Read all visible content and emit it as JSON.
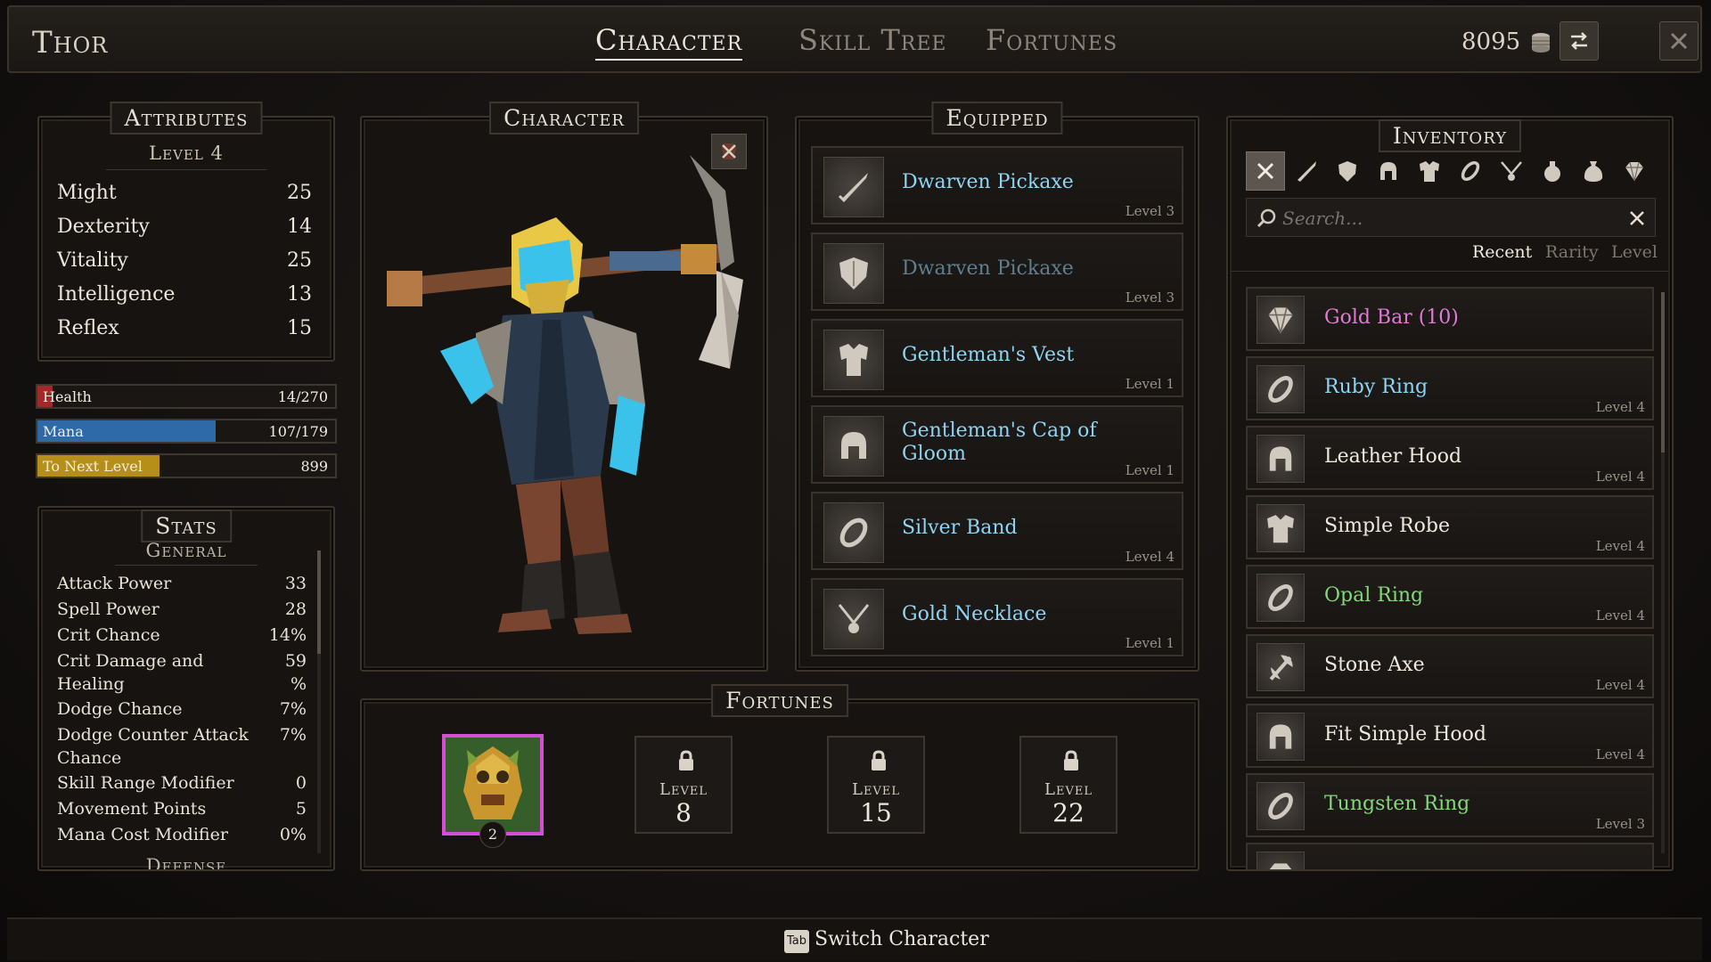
{
  "header": {
    "character_name": "Thor",
    "tabs": [
      {
        "label": "Character",
        "active": true
      },
      {
        "label": "Skill Tree",
        "active": false
      },
      {
        "label": "Fortunes",
        "active": false
      }
    ],
    "gold": "8095",
    "icons": {
      "gold": "coin-stack-icon",
      "switch": "swap-arrows-icon",
      "close": "close-icon"
    }
  },
  "attributes": {
    "title": "Attributes",
    "level": "Level 4",
    "rows": [
      {
        "name": "Might",
        "value": "25"
      },
      {
        "name": "Dexterity",
        "value": "14"
      },
      {
        "name": "Vitality",
        "value": "25"
      },
      {
        "name": "Intelligence",
        "value": "13"
      },
      {
        "name": "Reflex",
        "value": "15"
      }
    ]
  },
  "bars": {
    "health": {
      "label": "Health",
      "value": "14/270",
      "fraction": 0.05,
      "color": "#a3282a"
    },
    "mana": {
      "label": "Mana",
      "value": "107/179",
      "fraction": 0.6,
      "color": "#2e6aa8"
    },
    "xp": {
      "label": "To Next Level",
      "value": "899",
      "fraction": 0.41,
      "color": "#b58f18"
    }
  },
  "stats": {
    "title": "Stats",
    "group": "General",
    "rows": [
      {
        "name": "Attack Power",
        "value": "33"
      },
      {
        "name": "Spell Power",
        "value": "28"
      },
      {
        "name": "Crit Chance",
        "value": "14%"
      },
      {
        "name": "Crit Damage and Healing",
        "value": "59\n%"
      },
      {
        "name": "Dodge Chance",
        "value": "7%"
      },
      {
        "name": "Dodge Counter Attack Chance",
        "value": "7%"
      },
      {
        "name": "Skill Range Modifier",
        "value": "0"
      },
      {
        "name": "Movement Points",
        "value": "5"
      },
      {
        "name": "Mana Cost Modifier",
        "value": "0%"
      }
    ],
    "next_group": "Defense"
  },
  "character_panel": {
    "title": "Character",
    "badge_icon": "unequip-icon"
  },
  "equipped": {
    "title": "Equipped",
    "items": [
      {
        "name": "Dwarven Pickaxe",
        "level": "Level 3",
        "icon": "sword-icon",
        "dim": false
      },
      {
        "name": "Dwarven Pickaxe",
        "level": "Level 3",
        "icon": "shield-icon",
        "dim": true
      },
      {
        "name": "Gentleman's Vest",
        "level": "Level 1",
        "icon": "chest-armor-icon",
        "dim": false
      },
      {
        "name": "Gentleman's Cap of Gloom",
        "level": "Level 1",
        "icon": "helmet-icon",
        "dim": false
      },
      {
        "name": "Silver Band",
        "level": "Level 4",
        "icon": "ring-icon",
        "dim": false
      },
      {
        "name": "Gold Necklace",
        "level": "Level 1",
        "icon": "necklace-icon",
        "dim": false
      }
    ]
  },
  "fortunes": {
    "title": "Fortunes",
    "active_count": "2",
    "locked": [
      {
        "label": "Level",
        "value": "8"
      },
      {
        "label": "Level",
        "value": "15"
      },
      {
        "label": "Level",
        "value": "22"
      }
    ]
  },
  "inventory": {
    "title": "Inventory",
    "search_placeholder": "Search...",
    "filters": [
      "all-filter-icon",
      "weapon-filter-icon",
      "shield-filter-icon",
      "helmet-filter-icon",
      "armor-filter-icon",
      "ring-filter-icon",
      "necklace-filter-icon",
      "potion-filter-icon",
      "bag-filter-icon",
      "gem-filter-icon"
    ],
    "sort": {
      "recent": "Recent",
      "rarity": "Rarity",
      "level": "Level"
    },
    "items": [
      {
        "name": "Gold Bar  (10)",
        "level": "",
        "color": "#e279d8",
        "icon": "gem-icon"
      },
      {
        "name": "Ruby Ring",
        "level": "Level 4",
        "color": "#8fd4f2",
        "icon": "ring-icon"
      },
      {
        "name": "Leather Hood",
        "level": "Level 4",
        "color": "#efe8dd",
        "icon": "helmet-icon"
      },
      {
        "name": "Simple Robe",
        "level": "Level 4",
        "color": "#efe8dd",
        "icon": "chest-armor-icon"
      },
      {
        "name": "Opal Ring",
        "level": "Level 4",
        "color": "#86d67a",
        "icon": "ring-icon"
      },
      {
        "name": "Stone Axe",
        "level": "Level 4",
        "color": "#efe8dd",
        "icon": "axe-icon"
      },
      {
        "name": "Fit Simple Hood",
        "level": "Level 4",
        "color": "#efe8dd",
        "icon": "helmet-icon"
      },
      {
        "name": "Tungsten Ring",
        "level": "Level 3",
        "color": "#86d67a",
        "icon": "ring-icon"
      }
    ]
  },
  "footer": {
    "key": "Tab",
    "label": "Switch Character"
  }
}
